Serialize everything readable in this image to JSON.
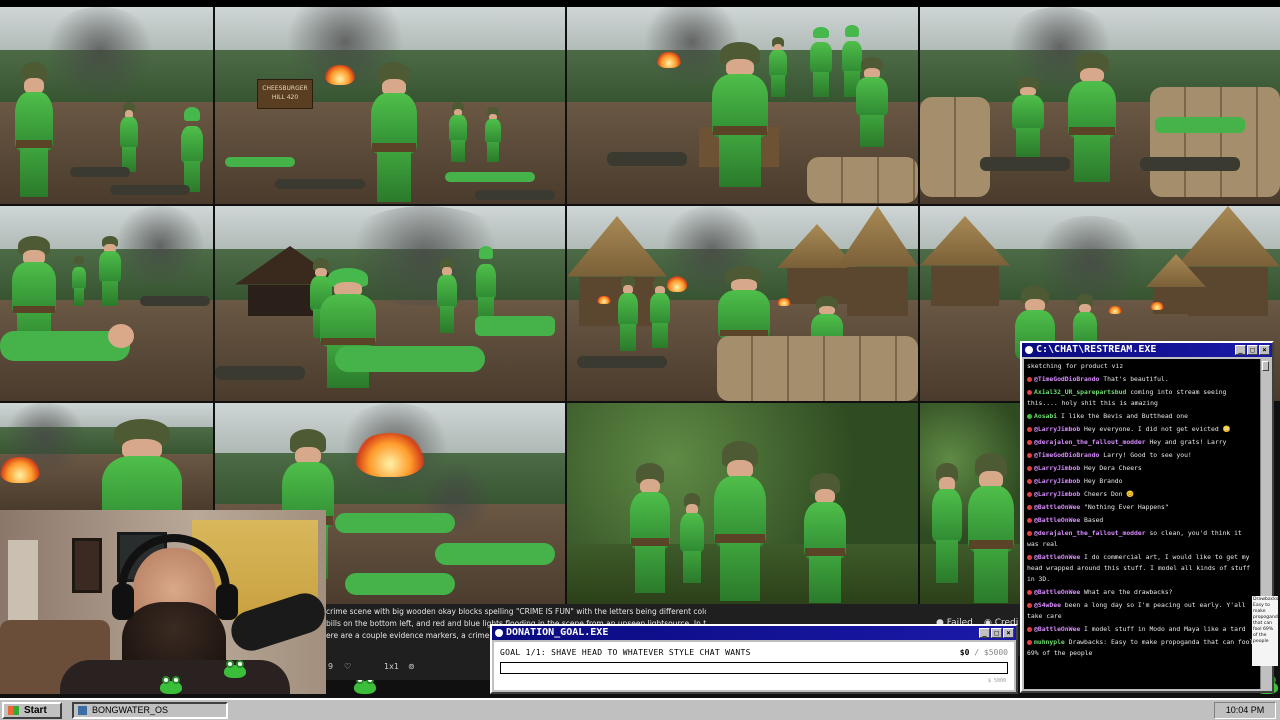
{
  "taskbar": {
    "start_label": "Start",
    "task_label": "BONGWATER_OS",
    "clock": "10:04 PM"
  },
  "grid": {
    "sign_text": "CHEESBURGER HILL 420"
  },
  "prompt_panel": {
    "lines": [
      "crime scene with big wooden okay blocks spelling \"CRIME IS FUN\" with the letters being different colors,",
      "bills  on the bottom left, and red and blue lights flooding in the scene from an unseen lightsource. In the",
      "ere are a couple evidence markers, a crime fold"
    ],
    "count": "9",
    "ratio": "1x1",
    "failed_label": "Failed",
    "credits_label": "Credi"
  },
  "chat": {
    "title": "C:\\CHAT\\RESTREAM.EXE",
    "messages": [
      {
        "user": "",
        "text": "sketching for product viz",
        "color": "#e8e8e8",
        "icon": ""
      },
      {
        "user": "@TimeGodDioBrando",
        "text": "That's beautiful.",
        "color": "#d98cff",
        "icon": "red"
      },
      {
        "user": "Axial32_UR_sparepartsbud",
        "text": "coming into stream seeing this.... holy shit this is amazing",
        "color": "#6fdc6f",
        "icon": "red"
      },
      {
        "user": "Aosabi",
        "text": "I like the Bevis and Butthead one",
        "color": "#6fdc6f",
        "icon": "green"
      },
      {
        "user": "@LarryJimbob",
        "text": "Hey everyone. I did not get evicted 😳",
        "color": "#d98cff",
        "icon": "red"
      },
      {
        "user": "@derajalen_the_fallout_modder",
        "text": "Hey and grats! Larry",
        "color": "#d98cff",
        "icon": "red"
      },
      {
        "user": "@TimeGodDioBrando",
        "text": "Larry! Good to see you!",
        "color": "#d98cff",
        "icon": "red"
      },
      {
        "user": "@LarryJimbob",
        "text": "Hey Dera Cheers",
        "color": "#d98cff",
        "icon": "red"
      },
      {
        "user": "@LarryJimbob",
        "text": "Hey Brando",
        "color": "#d98cff",
        "icon": "red"
      },
      {
        "user": "@LarryJimbob",
        "text": "Cheers Don 😊",
        "color": "#d98cff",
        "icon": "red"
      },
      {
        "user": "@BattleOnWee",
        "text": "\"Nothing Ever Happens\"",
        "color": "#d98cff",
        "icon": "red"
      },
      {
        "user": "@BattleOnWee",
        "text": "Based",
        "color": "#d98cff",
        "icon": "red"
      },
      {
        "user": "@derajalen_the_fallout_modder",
        "text": "so clean, you'd think it was real",
        "color": "#d98cff",
        "icon": "red"
      },
      {
        "user": "@BattleOnWee",
        "text": "I do commercial art, I would like to get my head wrapped around this stuff. I model all kinds of stuff in 3D.",
        "color": "#d98cff",
        "icon": "red"
      },
      {
        "user": "@BattleOnWee",
        "text": "What are the drawbacks?",
        "color": "#d98cff",
        "icon": "red"
      },
      {
        "user": "@S4wDee",
        "text": "been a long day so I'm peacing out early. Y'all take care",
        "color": "#d98cff",
        "icon": "red"
      },
      {
        "user": "@BattleOnWee",
        "text": "I model stuff in Modo and Maya like a tard",
        "color": "#d98cff",
        "icon": "red"
      },
      {
        "user": "muhnyple",
        "text": "Drawbacks: Easy to make propoganda that can fool 69% of the people",
        "color": "#6fdc6f",
        "icon": "red"
      }
    ]
  },
  "side_note": "Drawbacks: Easy to make propoganda that can fool 69% of the people",
  "donation": {
    "title": "DONATION_GOAL.EXE",
    "goal_text": "GOAL 1/1: SHAVE HEAD TO WHATEVER STYLE CHAT WANTS",
    "current": "$0",
    "target": "$5000",
    "progress": 0,
    "footer": "$ 5000"
  },
  "colors": {
    "titlebar": "#0a0a80",
    "chrome": "#c0c0c0",
    "frog_green": "#3bbf3b",
    "frog_pink": "#ff5c7a"
  },
  "icons": [
    "start-logo-icon",
    "window-icon",
    "minimize-icon",
    "maximize-icon",
    "close-icon",
    "heart-icon",
    "settings-icon"
  ]
}
